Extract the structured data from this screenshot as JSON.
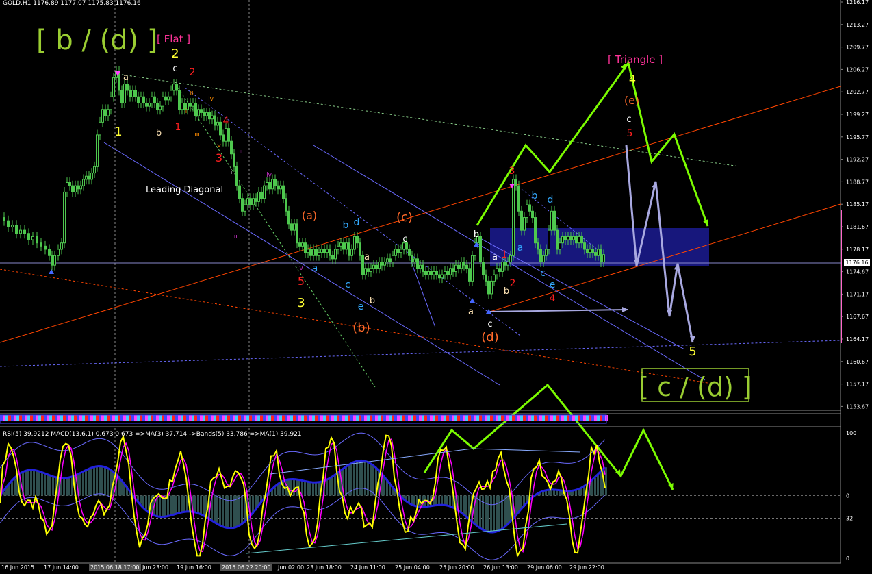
{
  "window": {
    "header": "GOLD,H1  1176.89 1177.07 1175.83 1176.16",
    "indicator_header": "RSI(5) 39.9212  MACD(13,6,1) 0.673 0.673  =>MA(3) 37.714  ->Bands(5) 33.786  =>MA(1) 39.921",
    "current_price": "1176.16"
  },
  "colors": {
    "background": "#000000",
    "candles": "#4ec84e",
    "big_label": "#9acd32",
    "projection": "#7cfc00",
    "projection_alt": "#a8a8e0",
    "box": "#1a1a8a",
    "trend_red": "#ff4500",
    "rsi": "#ffff00",
    "ma": "#ff00ff",
    "bands": "#6a6aff",
    "macd_hist": "#2f4f4f"
  },
  "chart_data": {
    "type": "candlestick",
    "symbol": "GOLD",
    "timeframe": "H1",
    "ylim": [
      1152,
      1216
    ],
    "y_ticks": [
      "1216.17",
      "1213.27",
      "1209.77",
      "1206.27",
      "1202.77",
      "1199.27",
      "1195.77",
      "1192.27",
      "1188.77",
      "1185.17",
      "1181.67",
      "1178.17",
      "1174.67",
      "1171.17",
      "1167.67",
      "1164.17",
      "1160.67",
      "1157.17",
      "1153.67"
    ],
    "x_ticks": [
      "16 Jun 2015",
      "17 Jun 14:00",
      "2015.06.18 17:00",
      "Jun 23:00",
      "19 Jun 16:00",
      "2015.06.22 20:00",
      "Jun 02:00",
      "23 Jun 18:00",
      "24 Jun 11:00",
      "25 Jun 04:00",
      "25 Jun 20:00",
      "26 Jun 13:00",
      "29 Jun 06:00",
      "29 Jun 22:00"
    ],
    "highlighted_times": [
      "2015.06.18 17:00",
      "2015.06.22 20:00"
    ],
    "price_path": [
      [
        0,
        1182
      ],
      [
        6,
        1181.5
      ],
      [
        12,
        1180.5
      ],
      [
        18,
        1180.8
      ],
      [
        24,
        1179.5
      ],
      [
        30,
        1180
      ],
      [
        36,
        1179.5
      ],
      [
        42,
        1178.5
      ],
      [
        48,
        1179
      ],
      [
        54,
        1178
      ],
      [
        60,
        1177.5
      ],
      [
        66,
        1177
      ],
      [
        72,
        1176
      ],
      [
        76,
        1174.5
      ],
      [
        80,
        1176
      ],
      [
        85,
        1177
      ],
      [
        90,
        1178
      ],
      [
        94,
        1186
      ],
      [
        98,
        1187.5
      ],
      [
        102,
        1187
      ],
      [
        106,
        1186
      ],
      [
        110,
        1187
      ],
      [
        114,
        1186.5
      ],
      [
        118,
        1187
      ],
      [
        122,
        1188
      ],
      [
        126,
        1188.5
      ],
      [
        130,
        1188
      ],
      [
        134,
        1189
      ],
      [
        138,
        1190
      ],
      [
        142,
        1195
      ],
      [
        146,
        1197
      ],
      [
        150,
        1199
      ],
      [
        154,
        1198
      ],
      [
        158,
        1199
      ],
      [
        162,
        1201
      ],
      [
        166,
        1204
      ],
      [
        170,
        1205
      ],
      [
        174,
        1202
      ],
      [
        178,
        1200
      ],
      [
        182,
        1203
      ],
      [
        186,
        1202
      ],
      [
        190,
        1201
      ],
      [
        194,
        1202
      ],
      [
        198,
        1201
      ],
      [
        202,
        1200
      ],
      [
        206,
        1201
      ],
      [
        210,
        1200
      ],
      [
        214,
        1199.5
      ],
      [
        218,
        1200
      ],
      [
        222,
        1201
      ],
      [
        226,
        1200
      ],
      [
        230,
        1199
      ],
      [
        234,
        1199.5
      ],
      [
        238,
        1201
      ],
      [
        242,
        1200.5
      ],
      [
        246,
        1201
      ],
      [
        250,
        1202
      ],
      [
        254,
        1203
      ],
      [
        258,
        1202
      ],
      [
        262,
        1199
      ],
      [
        266,
        1200
      ],
      [
        270,
        1199
      ],
      [
        274,
        1200
      ],
      [
        278,
        1199.5
      ],
      [
        282,
        1200
      ],
      [
        286,
        1198
      ],
      [
        290,
        1199
      ],
      [
        294,
        1198.5
      ],
      [
        298,
        1198
      ],
      [
        302,
        1198.5
      ],
      [
        306,
        1197.5
      ],
      [
        310,
        1198
      ],
      [
        314,
        1196.5
      ],
      [
        318,
        1197
      ],
      [
        322,
        1195
      ],
      [
        326,
        1194
      ],
      [
        330,
        1196
      ],
      [
        334,
        1194
      ],
      [
        338,
        1192
      ],
      [
        342,
        1190
      ],
      [
        346,
        1187
      ],
      [
        350,
        1185
      ],
      [
        354,
        1183
      ],
      [
        358,
        1184
      ],
      [
        362,
        1185
      ],
      [
        366,
        1184
      ],
      [
        370,
        1185
      ],
      [
        374,
        1184.5
      ],
      [
        378,
        1186
      ],
      [
        382,
        1185
      ],
      [
        386,
        1187
      ],
      [
        390,
        1187.5
      ],
      [
        394,
        1186.5
      ],
      [
        398,
        1188
      ],
      [
        402,
        1187
      ],
      [
        406,
        1186.5
      ],
      [
        410,
        1187
      ],
      [
        414,
        1185
      ],
      [
        418,
        1183
      ],
      [
        422,
        1181
      ],
      [
        426,
        1180
      ],
      [
        430,
        1181
      ],
      [
        434,
        1178
      ],
      [
        438,
        1177.5
      ],
      [
        442,
        1178
      ],
      [
        446,
        1176.5
      ],
      [
        450,
        1177
      ],
      [
        454,
        1176
      ],
      [
        458,
        1177
      ],
      [
        462,
        1176
      ],
      [
        466,
        1176.5
      ],
      [
        470,
        1177
      ],
      [
        474,
        1176.5
      ],
      [
        478,
        1177
      ],
      [
        482,
        1176
      ],
      [
        486,
        1175.5
      ],
      [
        490,
        1177
      ],
      [
        494,
        1177.5
      ],
      [
        498,
        1178
      ],
      [
        502,
        1177
      ],
      [
        506,
        1178
      ],
      [
        510,
        1176
      ],
      [
        514,
        1177
      ],
      [
        518,
        1179
      ],
      [
        522,
        1178
      ],
      [
        526,
        1176
      ],
      [
        530,
        1173
      ],
      [
        534,
        1174
      ],
      [
        538,
        1173.5
      ],
      [
        542,
        1174
      ],
      [
        546,
        1174.5
      ],
      [
        550,
        1174
      ],
      [
        554,
        1175
      ],
      [
        558,
        1174.5
      ],
      [
        562,
        1175
      ],
      [
        566,
        1175.5
      ],
      [
        570,
        1175
      ],
      [
        574,
        1176
      ],
      [
        578,
        1177
      ],
      [
        582,
        1176.5
      ],
      [
        586,
        1177
      ],
      [
        590,
        1178
      ],
      [
        594,
        1177
      ],
      [
        598,
        1176
      ],
      [
        602,
        1175
      ],
      [
        606,
        1175.5
      ],
      [
        610,
        1174
      ],
      [
        614,
        1174.5
      ],
      [
        618,
        1173.5
      ],
      [
        622,
        1173
      ],
      [
        626,
        1173.5
      ],
      [
        630,
        1173
      ],
      [
        634,
        1173.5
      ],
      [
        638,
        1173
      ],
      [
        642,
        1172.5
      ],
      [
        646,
        1173
      ],
      [
        650,
        1173.5
      ],
      [
        654,
        1173
      ],
      [
        658,
        1174
      ],
      [
        662,
        1173.5
      ],
      [
        666,
        1174.5
      ],
      [
        670,
        1174
      ],
      [
        674,
        1175
      ],
      [
        678,
        1174.5
      ],
      [
        682,
        1174
      ],
      [
        686,
        1172
      ],
      [
        690,
        1176
      ],
      [
        694,
        1178
      ],
      [
        698,
        1179
      ],
      [
        702,
        1175
      ],
      [
        706,
        1173
      ],
      [
        710,
        1172
      ],
      [
        714,
        1170
      ],
      [
        718,
        1172
      ],
      [
        722,
        1173
      ],
      [
        726,
        1174
      ],
      [
        730,
        1173.5
      ],
      [
        734,
        1175
      ],
      [
        738,
        1174.5
      ],
      [
        742,
        1175
      ],
      [
        746,
        1176
      ],
      [
        750,
        1188
      ],
      [
        754,
        1187
      ],
      [
        758,
        1183
      ],
      [
        762,
        1180
      ],
      [
        766,
        1182
      ],
      [
        770,
        1184
      ],
      [
        774,
        1183
      ],
      [
        778,
        1182
      ],
      [
        782,
        1178
      ],
      [
        786,
        1177
      ],
      [
        790,
        1175
      ],
      [
        794,
        1176
      ],
      [
        798,
        1177
      ],
      [
        802,
        1180
      ],
      [
        806,
        1183
      ],
      [
        810,
        1180
      ],
      [
        814,
        1177
      ],
      [
        818,
        1178
      ],
      [
        822,
        1179
      ],
      [
        826,
        1178.5
      ],
      [
        830,
        1179
      ],
      [
        834,
        1178.5
      ],
      [
        838,
        1179
      ],
      [
        842,
        1178
      ],
      [
        846,
        1179
      ],
      [
        850,
        1178
      ],
      [
        854,
        1177
      ],
      [
        858,
        1176.5
      ],
      [
        862,
        1177
      ],
      [
        866,
        1176.5
      ],
      [
        870,
        1176
      ],
      [
        874,
        1177
      ],
      [
        878,
        1175
      ],
      [
        882,
        1176.16
      ]
    ]
  },
  "labels": {
    "big_top": "[ b / (d) ]",
    "flat": "[ Flat ]",
    "triangle": "[ Triangle ]",
    "big_bottom": "[ c / (d) ]",
    "leading_diagonal": "Leading Diagonal",
    "waves": [
      {
        "text": "2",
        "color": "#ffff33",
        "x": 256,
        "y": 84,
        "size": 18
      },
      {
        "text": "c",
        "color": "#ffffff",
        "x": 256,
        "y": 104,
        "size": 13
      },
      {
        "text": "2",
        "color": "#ff2020",
        "x": 281,
        "y": 110,
        "size": 14
      },
      {
        "text": "a",
        "color": "#ffe4b5",
        "x": 184,
        "y": 117,
        "size": 13
      },
      {
        "text": "1",
        "color": "#ffff33",
        "x": 173,
        "y": 198,
        "size": 18
      },
      {
        "text": "b",
        "color": "#ffe4b5",
        "x": 232,
        "y": 198,
        "size": 13
      },
      {
        "text": "1",
        "color": "#ff2020",
        "x": 260,
        "y": 190,
        "size": 14
      },
      {
        "text": "ii",
        "color": "#ff8c00",
        "x": 280,
        "y": 138,
        "size": 9
      },
      {
        "text": "iv",
        "color": "#ff8c00",
        "x": 308,
        "y": 147,
        "size": 9
      },
      {
        "text": "i",
        "color": "#ff8c00",
        "x": 272,
        "y": 165,
        "size": 9
      },
      {
        "text": "iii",
        "color": "#ff8c00",
        "x": 288,
        "y": 199,
        "size": 9
      },
      {
        "text": "4",
        "color": "#ff2020",
        "x": 330,
        "y": 181,
        "size": 14
      },
      {
        "text": "v",
        "color": "#ff8c00",
        "x": 320,
        "y": 215,
        "size": 9
      },
      {
        "text": "3",
        "color": "#ff2020",
        "x": 320,
        "y": 236,
        "size": 16
      },
      {
        "text": "ii",
        "color": "#cc33cc",
        "x": 352,
        "y": 224,
        "size": 9
      },
      {
        "text": "i",
        "color": "#ffffff",
        "x": 338,
        "y": 254,
        "size": 9
      },
      {
        "text": "iv",
        "color": "#cc33cc",
        "x": 393,
        "y": 258,
        "size": 9
      },
      {
        "text": "iii",
        "color": "#cc33cc",
        "x": 343,
        "y": 348,
        "size": 9
      },
      {
        "text": "v",
        "color": "#cc33cc",
        "x": 440,
        "y": 394,
        "size": 9
      },
      {
        "text": "5",
        "color": "#ff2020",
        "x": 440,
        "y": 416,
        "size": 16
      },
      {
        "text": "3",
        "color": "#ffff33",
        "x": 440,
        "y": 448,
        "size": 18
      },
      {
        "text": "(a)",
        "color": "#ff6a2a",
        "x": 452,
        "y": 320,
        "size": 16
      },
      {
        "text": "a",
        "color": "#33aaff",
        "x": 460,
        "y": 396,
        "size": 14
      },
      {
        "text": "b",
        "color": "#33aaff",
        "x": 505,
        "y": 333,
        "size": 14
      },
      {
        "text": "d",
        "color": "#33aaff",
        "x": 521,
        "y": 329,
        "size": 14
      },
      {
        "text": "c",
        "color": "#33aaff",
        "x": 508,
        "y": 420,
        "size": 14
      },
      {
        "text": "e",
        "color": "#33aaff",
        "x": 527,
        "y": 452,
        "size": 14
      },
      {
        "text": "a",
        "color": "#ffe4b5",
        "x": 536,
        "y": 379,
        "size": 13
      },
      {
        "text": "b",
        "color": "#ffe4b5",
        "x": 544,
        "y": 443,
        "size": 13
      },
      {
        "text": "(b)",
        "color": "#ff6a2a",
        "x": 528,
        "y": 484,
        "size": 18
      },
      {
        "text": "(c)",
        "color": "#ff6a2a",
        "x": 591,
        "y": 323,
        "size": 18
      },
      {
        "text": "c",
        "color": "#ffffff",
        "x": 592,
        "y": 353,
        "size": 13
      },
      {
        "text": "b",
        "color": "#ffffff",
        "x": 696,
        "y": 346,
        "size": 13
      },
      {
        "text": "a",
        "color": "#ffe4b5",
        "x": 688,
        "y": 459,
        "size": 13
      },
      {
        "text": "c",
        "color": "#ffffff",
        "x": 716,
        "y": 477,
        "size": 13
      },
      {
        "text": "(d)",
        "color": "#ff6a2a",
        "x": 716,
        "y": 498,
        "size": 18
      },
      {
        "text": "a",
        "color": "#ffffff",
        "x": 723,
        "y": 379,
        "size": 13
      },
      {
        "text": "1",
        "color": "#ff2020",
        "x": 737,
        "y": 376,
        "size": 14
      },
      {
        "text": "b",
        "color": "#ffe4b5",
        "x": 740,
        "y": 429,
        "size": 13
      },
      {
        "text": "2",
        "color": "#ff2020",
        "x": 749,
        "y": 418,
        "size": 14
      },
      {
        "text": "3",
        "color": "#ff2020",
        "x": 748,
        "y": 254,
        "size": 14
      },
      {
        "text": "a",
        "color": "#33aaff",
        "x": 760,
        "y": 366,
        "size": 14
      },
      {
        "text": "b",
        "color": "#33aaff",
        "x": 781,
        "y": 290,
        "size": 14
      },
      {
        "text": "d",
        "color": "#33aaff",
        "x": 804,
        "y": 296,
        "size": 14
      },
      {
        "text": "c",
        "color": "#33aaff",
        "x": 793,
        "y": 403,
        "size": 14
      },
      {
        "text": "e",
        "color": "#33aaff",
        "x": 807,
        "y": 420,
        "size": 14
      },
      {
        "text": "4",
        "color": "#ff2020",
        "x": 807,
        "y": 440,
        "size": 14
      },
      {
        "text": "4",
        "color": "#ffff33",
        "x": 924,
        "y": 121,
        "size": 16
      },
      {
        "text": "(e)",
        "color": "#ff6a2a",
        "x": 923,
        "y": 152,
        "size": 16
      },
      {
        "text": "c",
        "color": "#ffffff",
        "x": 919,
        "y": 178,
        "size": 13
      },
      {
        "text": "5",
        "color": "#ff2020",
        "x": 920,
        "y": 199,
        "size": 14
      },
      {
        "text": "5",
        "color": "#ffff33",
        "x": 1012,
        "y": 519,
        "size": 18
      }
    ]
  }
}
